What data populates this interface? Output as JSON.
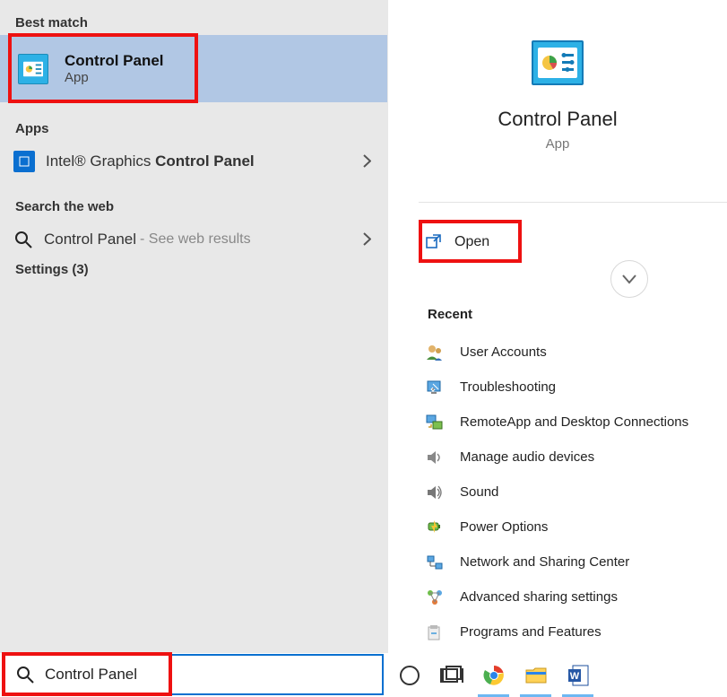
{
  "sections": {
    "best_match": "Best match",
    "apps": "Apps",
    "search_web": "Search the web",
    "settings": "Settings (3)",
    "recent": "Recent"
  },
  "best_match_item": {
    "title": "Control Panel",
    "subtitle": "App"
  },
  "apps_item": {
    "prefix": "Intel® Graphics ",
    "bold": "Control Panel"
  },
  "web_item": {
    "label": "Control Panel",
    "suffix": " - See web results"
  },
  "hero": {
    "title": "Control Panel",
    "subtitle": "App"
  },
  "open_action": "Open",
  "recent_items": [
    "User Accounts",
    "Troubleshooting",
    "RemoteApp and Desktop Connections",
    "Manage audio devices",
    "Sound",
    "Power Options",
    "Network and Sharing Center",
    "Advanced sharing settings",
    "Programs and Features"
  ],
  "search": {
    "value": "Control Panel"
  }
}
